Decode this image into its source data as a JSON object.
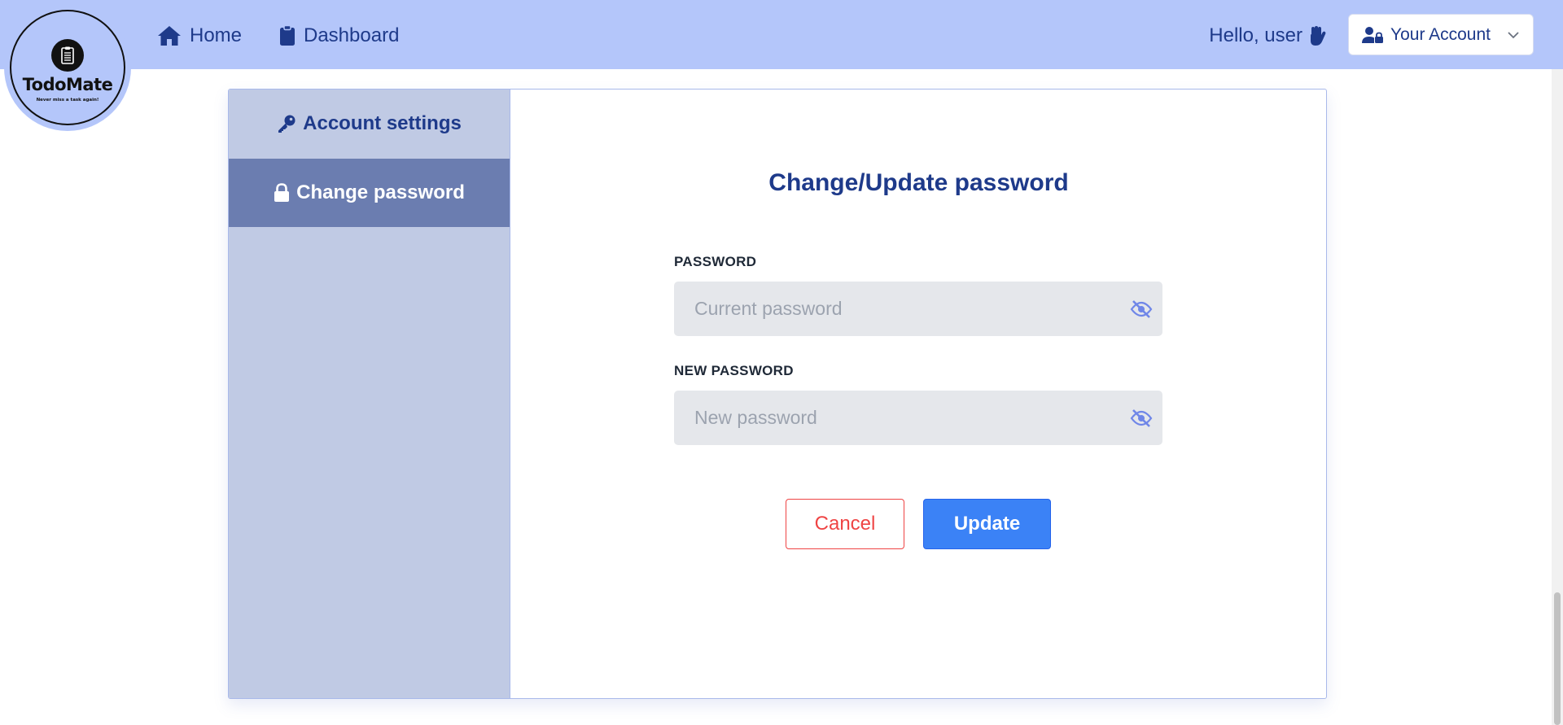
{
  "brand": {
    "name": "TodoMate",
    "tagline": "Never miss a task again!"
  },
  "nav": {
    "home": "Home",
    "dashboard": "Dashboard",
    "greeting": "Hello, user",
    "account_button": "Your Account"
  },
  "sidebar": {
    "items": [
      {
        "label": "Account settings",
        "icon": "key-icon",
        "active": false
      },
      {
        "label": "Change password",
        "icon": "lock-icon",
        "active": true
      }
    ]
  },
  "form": {
    "title": "Change/Update password",
    "current": {
      "label": "PASSWORD",
      "placeholder": "Current password",
      "value": ""
    },
    "new": {
      "label": "NEW PASSWORD",
      "placeholder": "New password",
      "value": ""
    },
    "cancel_label": "Cancel",
    "update_label": "Update"
  },
  "colors": {
    "navbar": "#b4c6fa",
    "brand_text": "#1e3a8a",
    "sidebar": "#c0cae4",
    "sidebar_active": "#6b7db0",
    "primary": "#3b82f6",
    "danger": "#ef4444"
  }
}
